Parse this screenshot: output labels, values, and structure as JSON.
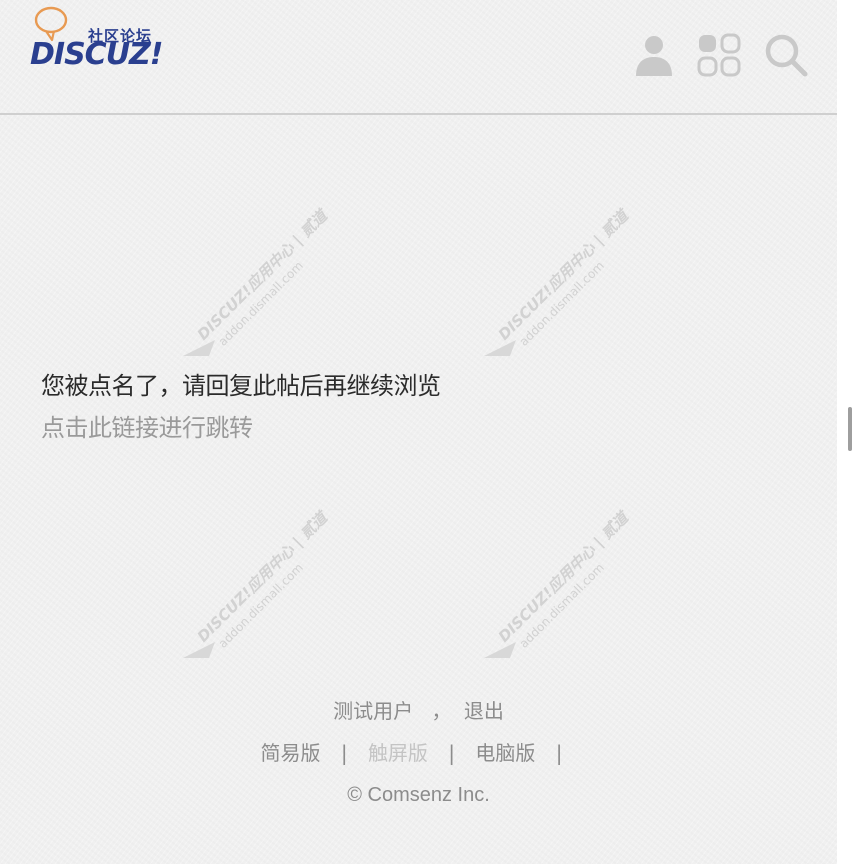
{
  "header": {
    "logo": {
      "tagline": "社区论坛",
      "brand": "DISCUZ!",
      "brand_color": "#2a3f8f",
      "accent_color": "#e89a52"
    },
    "icons": [
      "user-icon",
      "grid-icon",
      "search-icon"
    ]
  },
  "watermark": {
    "line1": "DISCUZ!应用中心 | 贰道",
    "line2": "addon.dismall.com"
  },
  "main": {
    "message": "您被点名了，请回复此帖后再继续浏览",
    "link_text": "点击此链接进行跳转"
  },
  "footer": {
    "username": "测试用户",
    "comma": "，",
    "logout": "退出",
    "modes": [
      "简易版",
      "触屏版",
      "电脑版"
    ],
    "separator": "|",
    "copyright": "© Comsenz Inc."
  }
}
